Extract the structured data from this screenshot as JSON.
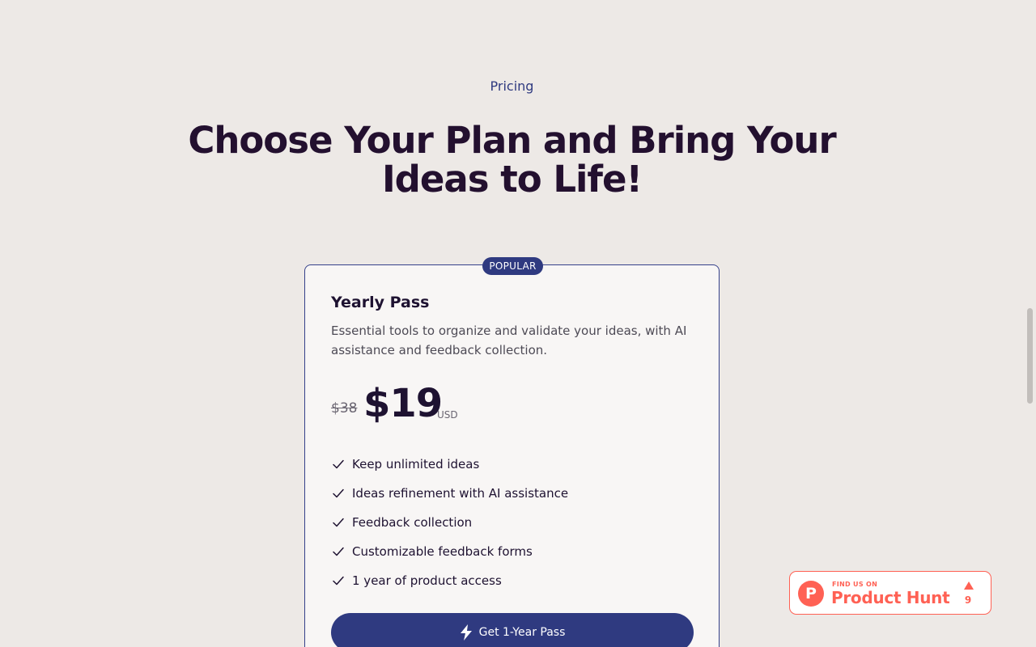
{
  "section": {
    "eyebrow": "Pricing",
    "headline": "Choose Your Plan and Bring Your Ideas to Life!"
  },
  "plan": {
    "badge": "POPULAR",
    "name": "Yearly Pass",
    "description": "Essential tools to organize and validate your ideas, with AI assistance and feedback collection.",
    "old_price": "$38",
    "price": "$19",
    "currency": "USD",
    "features": [
      "Keep unlimited ideas",
      "Ideas refinement with AI assistance",
      "Feedback collection",
      "Customizable feedback forms",
      "1 year of product access"
    ],
    "cta_label": "Get 1-Year Pass",
    "cta_icon": "lightning-icon",
    "feature_icon": "check-icon"
  },
  "product_hunt": {
    "logo_letter": "P",
    "tagline": "FIND US ON",
    "name": "Product Hunt",
    "upvotes": "9"
  },
  "colors": {
    "background": "#ede9e6",
    "accent": "#2f3a80",
    "heading": "#23102f",
    "product_hunt": "#ff6154"
  }
}
